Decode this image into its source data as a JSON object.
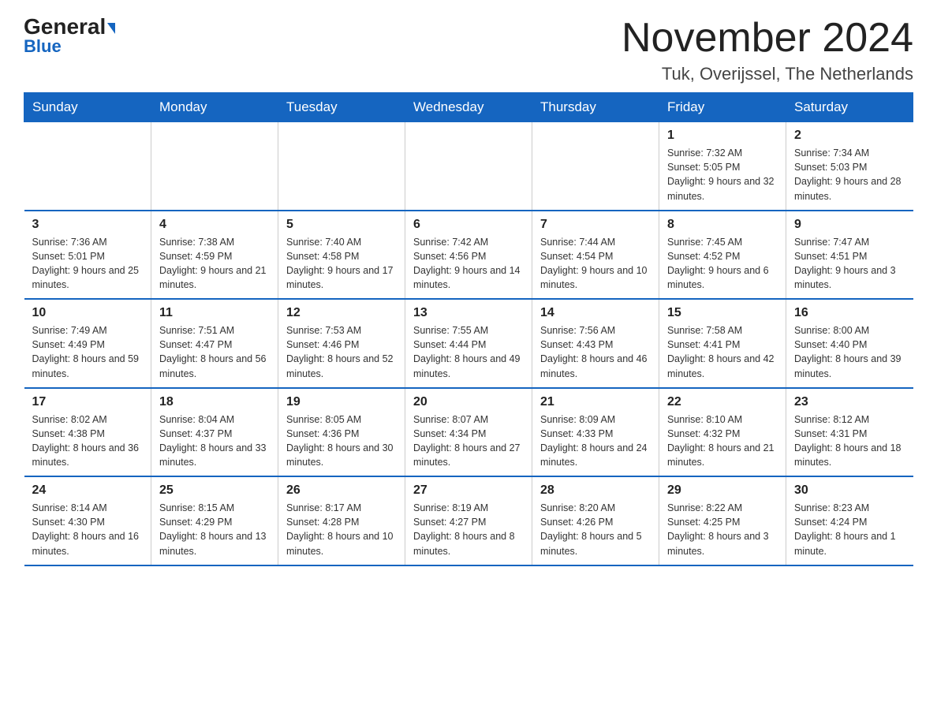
{
  "header": {
    "logo_general": "General",
    "logo_blue": "Blue",
    "month_title": "November 2024",
    "location": "Tuk, Overijssel, The Netherlands"
  },
  "days_of_week": [
    "Sunday",
    "Monday",
    "Tuesday",
    "Wednesday",
    "Thursday",
    "Friday",
    "Saturday"
  ],
  "weeks": [
    [
      {
        "day": "",
        "info": ""
      },
      {
        "day": "",
        "info": ""
      },
      {
        "day": "",
        "info": ""
      },
      {
        "day": "",
        "info": ""
      },
      {
        "day": "",
        "info": ""
      },
      {
        "day": "1",
        "info": "Sunrise: 7:32 AM\nSunset: 5:05 PM\nDaylight: 9 hours and 32 minutes."
      },
      {
        "day": "2",
        "info": "Sunrise: 7:34 AM\nSunset: 5:03 PM\nDaylight: 9 hours and 28 minutes."
      }
    ],
    [
      {
        "day": "3",
        "info": "Sunrise: 7:36 AM\nSunset: 5:01 PM\nDaylight: 9 hours and 25 minutes."
      },
      {
        "day": "4",
        "info": "Sunrise: 7:38 AM\nSunset: 4:59 PM\nDaylight: 9 hours and 21 minutes."
      },
      {
        "day": "5",
        "info": "Sunrise: 7:40 AM\nSunset: 4:58 PM\nDaylight: 9 hours and 17 minutes."
      },
      {
        "day": "6",
        "info": "Sunrise: 7:42 AM\nSunset: 4:56 PM\nDaylight: 9 hours and 14 minutes."
      },
      {
        "day": "7",
        "info": "Sunrise: 7:44 AM\nSunset: 4:54 PM\nDaylight: 9 hours and 10 minutes."
      },
      {
        "day": "8",
        "info": "Sunrise: 7:45 AM\nSunset: 4:52 PM\nDaylight: 9 hours and 6 minutes."
      },
      {
        "day": "9",
        "info": "Sunrise: 7:47 AM\nSunset: 4:51 PM\nDaylight: 9 hours and 3 minutes."
      }
    ],
    [
      {
        "day": "10",
        "info": "Sunrise: 7:49 AM\nSunset: 4:49 PM\nDaylight: 8 hours and 59 minutes."
      },
      {
        "day": "11",
        "info": "Sunrise: 7:51 AM\nSunset: 4:47 PM\nDaylight: 8 hours and 56 minutes."
      },
      {
        "day": "12",
        "info": "Sunrise: 7:53 AM\nSunset: 4:46 PM\nDaylight: 8 hours and 52 minutes."
      },
      {
        "day": "13",
        "info": "Sunrise: 7:55 AM\nSunset: 4:44 PM\nDaylight: 8 hours and 49 minutes."
      },
      {
        "day": "14",
        "info": "Sunrise: 7:56 AM\nSunset: 4:43 PM\nDaylight: 8 hours and 46 minutes."
      },
      {
        "day": "15",
        "info": "Sunrise: 7:58 AM\nSunset: 4:41 PM\nDaylight: 8 hours and 42 minutes."
      },
      {
        "day": "16",
        "info": "Sunrise: 8:00 AM\nSunset: 4:40 PM\nDaylight: 8 hours and 39 minutes."
      }
    ],
    [
      {
        "day": "17",
        "info": "Sunrise: 8:02 AM\nSunset: 4:38 PM\nDaylight: 8 hours and 36 minutes."
      },
      {
        "day": "18",
        "info": "Sunrise: 8:04 AM\nSunset: 4:37 PM\nDaylight: 8 hours and 33 minutes."
      },
      {
        "day": "19",
        "info": "Sunrise: 8:05 AM\nSunset: 4:36 PM\nDaylight: 8 hours and 30 minutes."
      },
      {
        "day": "20",
        "info": "Sunrise: 8:07 AM\nSunset: 4:34 PM\nDaylight: 8 hours and 27 minutes."
      },
      {
        "day": "21",
        "info": "Sunrise: 8:09 AM\nSunset: 4:33 PM\nDaylight: 8 hours and 24 minutes."
      },
      {
        "day": "22",
        "info": "Sunrise: 8:10 AM\nSunset: 4:32 PM\nDaylight: 8 hours and 21 minutes."
      },
      {
        "day": "23",
        "info": "Sunrise: 8:12 AM\nSunset: 4:31 PM\nDaylight: 8 hours and 18 minutes."
      }
    ],
    [
      {
        "day": "24",
        "info": "Sunrise: 8:14 AM\nSunset: 4:30 PM\nDaylight: 8 hours and 16 minutes."
      },
      {
        "day": "25",
        "info": "Sunrise: 8:15 AM\nSunset: 4:29 PM\nDaylight: 8 hours and 13 minutes."
      },
      {
        "day": "26",
        "info": "Sunrise: 8:17 AM\nSunset: 4:28 PM\nDaylight: 8 hours and 10 minutes."
      },
      {
        "day": "27",
        "info": "Sunrise: 8:19 AM\nSunset: 4:27 PM\nDaylight: 8 hours and 8 minutes."
      },
      {
        "day": "28",
        "info": "Sunrise: 8:20 AM\nSunset: 4:26 PM\nDaylight: 8 hours and 5 minutes."
      },
      {
        "day": "29",
        "info": "Sunrise: 8:22 AM\nSunset: 4:25 PM\nDaylight: 8 hours and 3 minutes."
      },
      {
        "day": "30",
        "info": "Sunrise: 8:23 AM\nSunset: 4:24 PM\nDaylight: 8 hours and 1 minute."
      }
    ]
  ]
}
